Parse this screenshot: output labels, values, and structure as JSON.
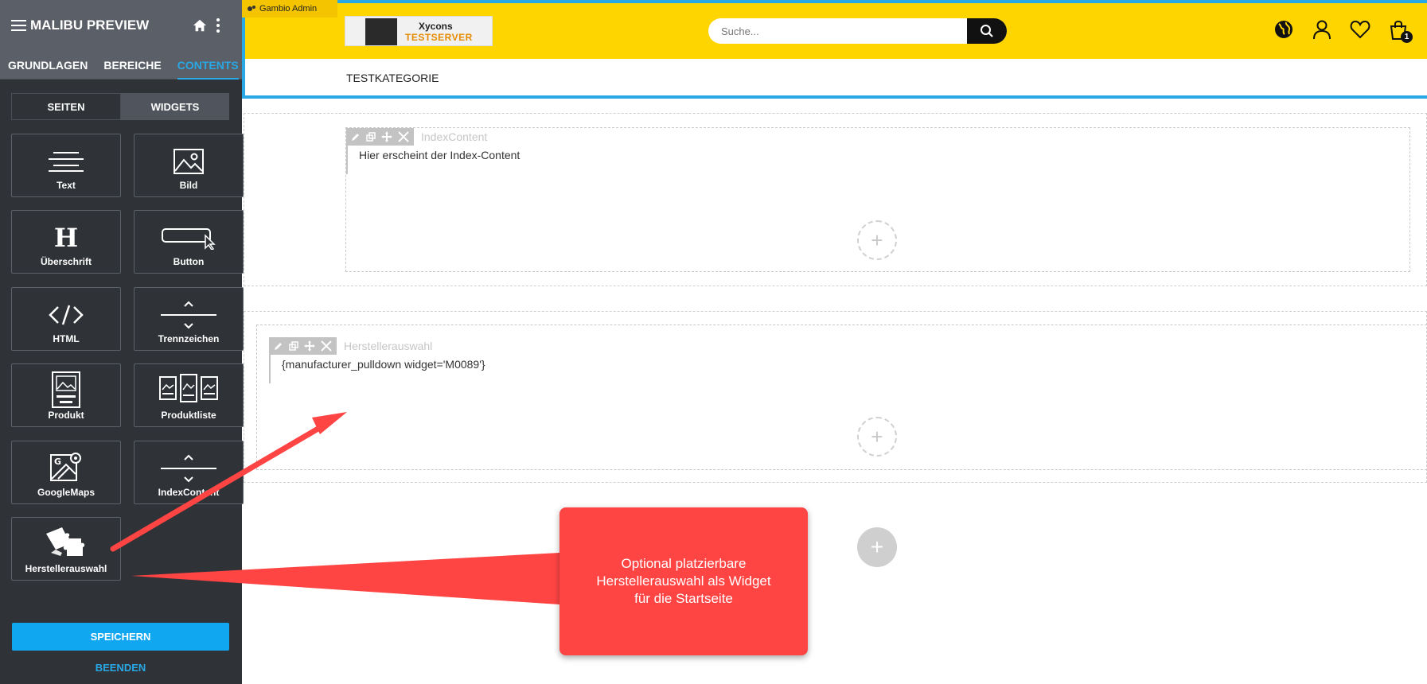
{
  "sidebar": {
    "title": "MALIBU PREVIEW",
    "tabs": [
      {
        "label": "GRUNDLAGEN",
        "active": false
      },
      {
        "label": "BEREICHE",
        "active": false
      },
      {
        "label": "CONTENTS",
        "active": true
      }
    ],
    "toggle": {
      "seiten": "SEITEN",
      "widgets": "WIDGETS"
    },
    "widgets": [
      {
        "label": "Text",
        "icon": "text-lines-icon"
      },
      {
        "label": "Bild",
        "icon": "image-icon"
      },
      {
        "label": "Überschrift",
        "icon": "heading-icon"
      },
      {
        "label": "Button",
        "icon": "button-icon"
      },
      {
        "label": "HTML",
        "icon": "code-icon"
      },
      {
        "label": "Trennzeichen",
        "icon": "divider-icon"
      },
      {
        "label": "Produkt",
        "icon": "product-icon"
      },
      {
        "label": "Produktliste",
        "icon": "product-list-icon"
      },
      {
        "label": "GoogleMaps",
        "icon": "map-icon"
      },
      {
        "label": "IndexContent",
        "icon": "index-content-icon"
      },
      {
        "label": "Herstellerauswahl",
        "icon": "puzzle-icon"
      }
    ],
    "save_label": "SPEICHERN",
    "exit_label": "BEENDEN"
  },
  "admin_bar": {
    "label": "Gambio Admin"
  },
  "header": {
    "logo_line1": "Xycons",
    "logo_line2": "TESTSERVER",
    "search_placeholder": "Suche...",
    "cart_count": "1",
    "category": "TESTKATEGORIE"
  },
  "content": {
    "widget1": {
      "name": "IndexContent",
      "body": "Hier erscheint der Index-Content"
    },
    "widget2": {
      "name": "Herstellerauswahl",
      "body": "{manufacturer_pulldown widget='M0089'}"
    },
    "plus_symbol": "+"
  },
  "callout": {
    "line1": "Optional platzierbare",
    "line2": "Herstellerauswahl als Widget",
    "line3": "für die Startseite"
  },
  "colors": {
    "accent": "#29a8e6",
    "header_yellow": "#ffd500",
    "callout_red": "#ff4444"
  }
}
